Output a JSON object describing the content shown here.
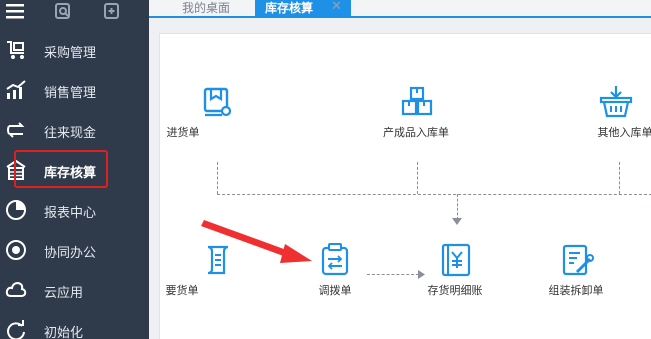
{
  "sidebar": {
    "items": [
      {
        "label": "采购管理",
        "icon": "purchase-cart-icon"
      },
      {
        "label": "销售管理",
        "icon": "sales-chart-icon"
      },
      {
        "label": "往来现金",
        "icon": "exchange-arrows-icon"
      },
      {
        "label": "库存核算",
        "icon": "warehouse-icon",
        "active": true
      },
      {
        "label": "报表中心",
        "icon": "pie-report-icon"
      },
      {
        "label": "协同办公",
        "icon": "collaboration-icon"
      },
      {
        "label": "云应用",
        "icon": "cloud-icon"
      },
      {
        "label": "初始化",
        "icon": "refresh-icon"
      }
    ],
    "top_icons": [
      "menu-icon",
      "search-doc-icon",
      "add-page-icon"
    ]
  },
  "tabs": [
    {
      "label": "我的桌面",
      "active": false
    },
    {
      "label": "库存核算",
      "active": true
    }
  ],
  "flow": {
    "top_row": [
      {
        "label": "进货单",
        "icon": "purchase-receipt-icon"
      },
      {
        "label": "产成品入库单",
        "icon": "boxes-icon"
      },
      {
        "label": "其他入库单",
        "icon": "basket-in-icon"
      }
    ],
    "bottom_row": [
      {
        "label": "要货单",
        "icon": "scroll-doc-icon"
      },
      {
        "label": "调拨单",
        "icon": "clipboard-transfer-icon"
      },
      {
        "label": "存货明细账",
        "icon": "ledger-yen-icon"
      },
      {
        "label": "组装拆卸单",
        "icon": "assembly-doc-icon"
      }
    ]
  },
  "colors": {
    "sidebar_bg": "#2f3a4a",
    "accent": "#1e90e6",
    "highlight": "#e02020",
    "arrow": "#f03030"
  }
}
